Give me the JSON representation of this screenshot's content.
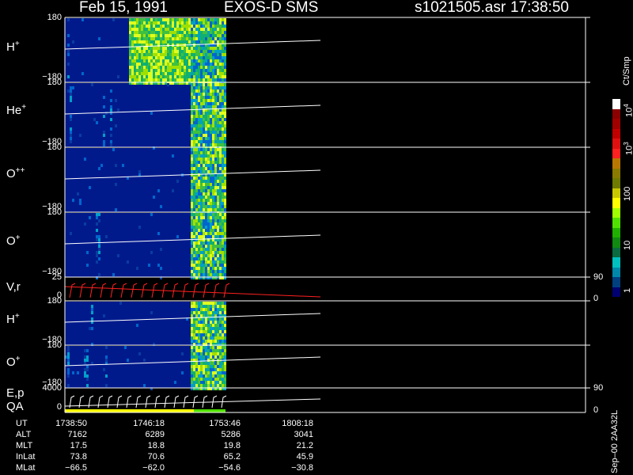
{
  "header": {
    "date": "Feb 15, 1991",
    "instrument": "EXOS-D SMS",
    "file": "s1021505.asr",
    "time": "17:38:50"
  },
  "panels": [
    {
      "label": "H",
      "sup": "+",
      "ymax": "180",
      "ymin": "−180"
    },
    {
      "label": "He",
      "sup": "+",
      "ymax": "180",
      "ymin": "−180"
    },
    {
      "label": "O",
      "sup": "++",
      "ymax": "180",
      "ymin": "−180"
    },
    {
      "label": "O",
      "sup": "+",
      "ymax": "180",
      "ymin": "−180"
    },
    {
      "label": "V,r",
      "sup": "",
      "ymax": "25",
      "ymin": "0",
      "rmax": "90",
      "rmin": "0"
    },
    {
      "label": "H",
      "sup": "+",
      "ymax": "180",
      "ymin": "−180"
    },
    {
      "label": "O",
      "sup": "+",
      "ymax": "180",
      "ymin": "−180"
    },
    {
      "label": "E,p",
      "label2": "QA",
      "sup": "",
      "ymax": "4000",
      "ymin": "0",
      "rmax": "90",
      "rmin": "0"
    }
  ],
  "ephemeris": {
    "rows": [
      {
        "name": "UT",
        "values": [
          "1738:50",
          "1746:18",
          "1753:46",
          "1808:18"
        ]
      },
      {
        "name": "ALT",
        "values": [
          "7162",
          "6289",
          "5286",
          "3041"
        ]
      },
      {
        "name": "MLT",
        "values": [
          "17.5",
          "18.8",
          "19.8",
          "21.2"
        ]
      },
      {
        "name": "InLat",
        "values": [
          "73.8",
          "70.6",
          "65.2",
          "45.9"
        ]
      },
      {
        "name": "MLat",
        "values": [
          "−66.5",
          "−62.0",
          "−54.6",
          "−30.8"
        ]
      }
    ]
  },
  "colorbar": {
    "unit": "Ct/Smp",
    "labels": {
      "1e4": "10",
      "1e4sup": "4",
      "1e3": "10",
      "1e3sup": "3",
      "100": "100",
      "10": "10",
      "1": "1"
    },
    "colors": [
      "#ffffff",
      "#8b0000",
      "#a00000",
      "#c00000",
      "#e01010",
      "#ff2020",
      "#b87800",
      "#8a7a00",
      "#6e7a00",
      "#c8c800",
      "#ffff00",
      "#a0ff00",
      "#50e000",
      "#20b000",
      "#108a10",
      "#0a6a40",
      "#00c0c0",
      "#0088aa",
      "#004080",
      "#000070"
    ]
  },
  "footer": {
    "code": "Sep–00 2AA32L"
  },
  "accent": {
    "grid": "#ffffff",
    "trace": "#ff2020",
    "bg_panel": "#001a8c"
  },
  "chart_data": {
    "type": "heatmap",
    "title": "Feb 15, 1991 EXOS-D SMS",
    "panels": [
      "H+",
      "He+",
      "O++",
      "O+",
      "V,r",
      "H+",
      "O+",
      "E,p / QA"
    ],
    "colorbar_unit": "Ct/Smp",
    "colorbar_range": [
      1,
      10000
    ],
    "colorbar_scale": "log",
    "x_ticks_UT": [
      "1738:50",
      "1746:18",
      "1753:46",
      "1808:18"
    ]
  }
}
